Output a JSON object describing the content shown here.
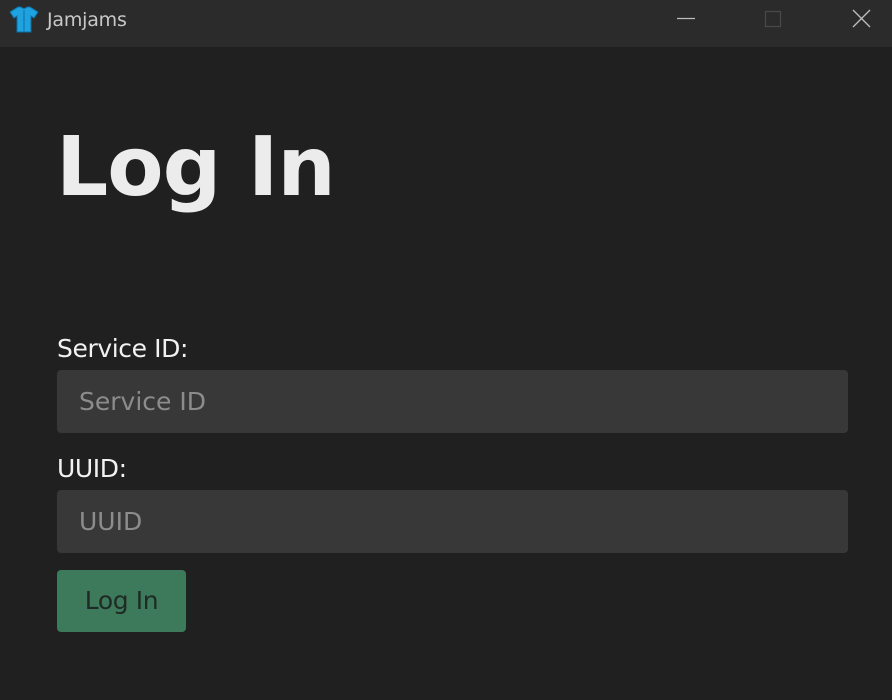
{
  "window": {
    "title": "Jamjams",
    "icon": "shirt-icon",
    "controls": [
      "minimize-icon",
      "maximize-icon",
      "close-icon"
    ]
  },
  "login": {
    "heading": "Log In",
    "service_id": {
      "label": "Service ID:",
      "placeholder": "Service ID",
      "value": ""
    },
    "uuid": {
      "label": "UUID:",
      "placeholder": "UUID",
      "value": ""
    },
    "submit_label": "Log In"
  },
  "colors": {
    "background": "#202020",
    "titlebar": "#2b2b2b",
    "input_background": "#383838",
    "accent": "#3d7a5c",
    "icon_blue": "#1fa3e0"
  }
}
